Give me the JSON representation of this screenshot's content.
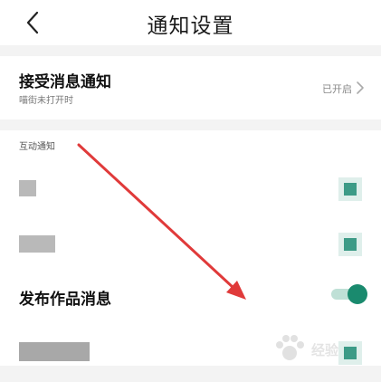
{
  "header": {
    "title": "通知设置",
    "back_icon": "chevron-left-icon"
  },
  "receive_notifications": {
    "title": "接受消息通知",
    "subtitle": "喵街未打开时",
    "status": "已开启",
    "chevron_icon": "chevron-right-icon"
  },
  "interaction_section": {
    "label": "互动通知"
  },
  "publish_works": {
    "title": "发布作品消息",
    "switch_on": true
  },
  "colors": {
    "accent": "#1a8a6e",
    "arrow": "#e03a3a"
  },
  "watermark": {
    "text": "经验"
  }
}
